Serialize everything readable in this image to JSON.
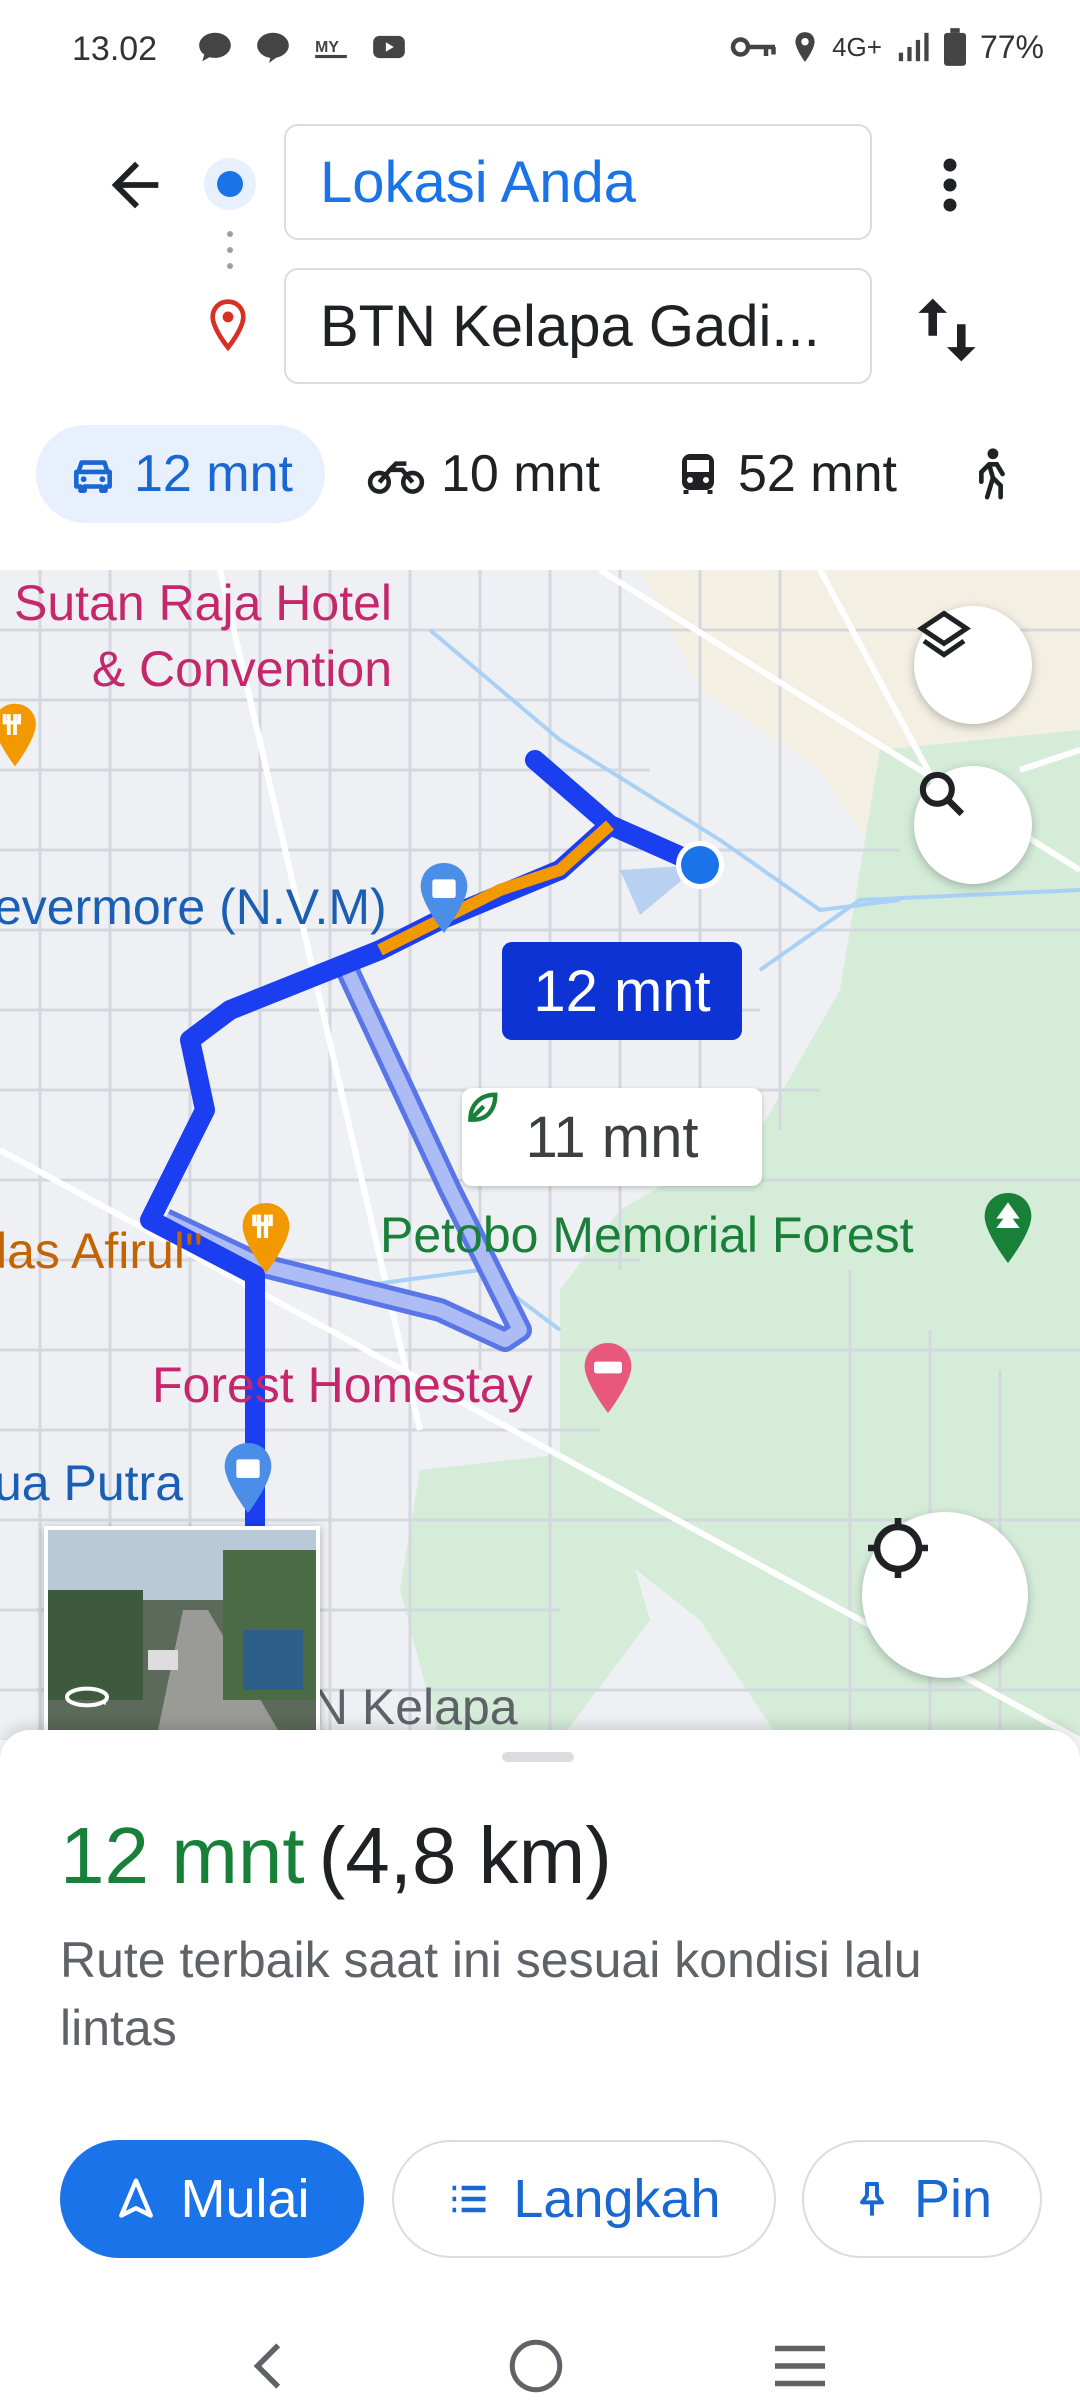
{
  "status": {
    "time": "13.02",
    "network": "4G+",
    "battery": "77%"
  },
  "search": {
    "origin": "Lokasi Anda",
    "destination": "BTN Kelapa Gadi..."
  },
  "modes": [
    {
      "icon": "car-icon",
      "label": "12 mnt",
      "active": true
    },
    {
      "icon": "motorcycle-icon",
      "label": "10 mnt"
    },
    {
      "icon": "transit-icon",
      "label": "52 mnt"
    },
    {
      "icon": "walk-icon",
      "label": ""
    }
  ],
  "map": {
    "places": {
      "hotel": "Sutan Raja Hotel\n& Convention",
      "nvm": "evermore (N.V.M)",
      "forest": "Petobo Memorial Forest",
      "afirul": "las Afirul\"",
      "homestay": "Forest Homestay",
      "putra": "ua Putra",
      "btn": "BTN Kelapa"
    },
    "route_time": "12 mnt",
    "alt_route_time": "11 mnt"
  },
  "sheet": {
    "duration": "12 mnt",
    "distance": "(4,8 km)",
    "description": "Rute terbaik saat ini sesuai kondisi lalu lintas",
    "start_label": "Mulai",
    "steps_label": "Langkah",
    "pin_label": "Pin"
  },
  "colors": {
    "accent": "#1a73e8",
    "route": "#1a3ef0",
    "traffic": "#f29900",
    "green": "#188038"
  }
}
